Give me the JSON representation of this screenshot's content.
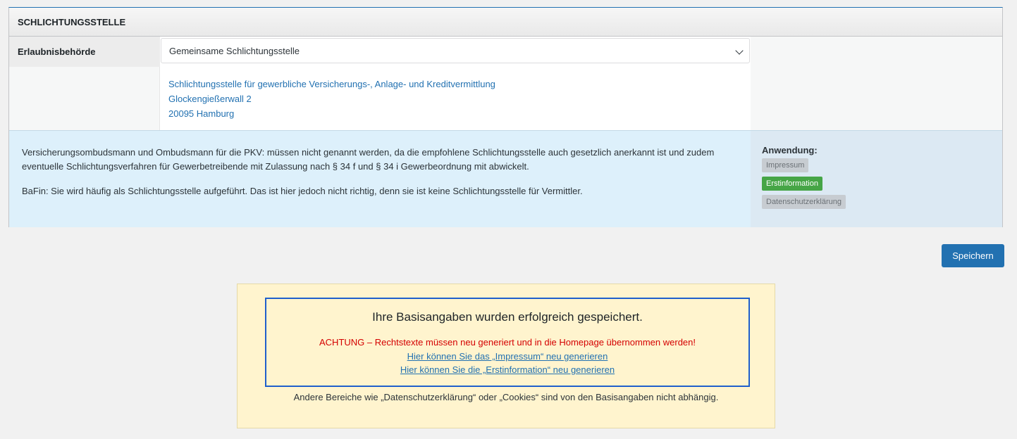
{
  "section": {
    "title": "SCHLICHTUNGSSTELLE",
    "field_label": "Erlaubnisbehörde",
    "select_value": "Gemeinsame Schlichtungsstelle",
    "address": [
      "Schlichtungsstelle für gewerbliche Versicherungs-, Anlage- und Kreditvermittlung",
      "Glockengießerwall 2",
      "20095 Hamburg"
    ],
    "info": [
      "Versicherungsombudsmann und Ombudsmann für die PKV: müssen nicht genannt werden, da die empfohlene Schlichtungsstelle auch gesetzlich anerkannt ist und zudem eventuelle Schlichtungsverfahren für Gewerbetreibende mit Zulassung nach § 34 f und § 34 i Gewerbeordnung mit abwickelt.",
      "BaFin: Sie wird häufig als Schlichtungsstelle aufgeführt. Das ist hier jedoch nicht richtig, denn sie ist keine Schlichtungsstelle für Vermittler."
    ],
    "usage_title": "Anwendung:",
    "usage_badges": [
      "Impressum",
      "Erstinformation",
      "Datenschutzerklärung"
    ]
  },
  "actions": {
    "save_label": "Speichern"
  },
  "notice": {
    "heading": "Ihre Basisangaben wurden erfolgreich gespeichert.",
    "warning": "ACHTUNG – Rechtstexte müssen neu generiert und in die Homepage übernommen werden!",
    "link_impressum": "Hier können Sie das „Impressum“ neu generieren",
    "link_erstinformation": "Hier können Sie die „Erstinformation“ neu generieren",
    "footer": "Andere Bereiche wie „Datenschutzerklärung“ oder „Cookies“ sind von den Basisangaben nicht abhängig."
  },
  "colors": {
    "accent": "#2271b1",
    "active_badge": "#46a546",
    "warning": "#d40000",
    "notice_bg": "#fff4ce"
  }
}
